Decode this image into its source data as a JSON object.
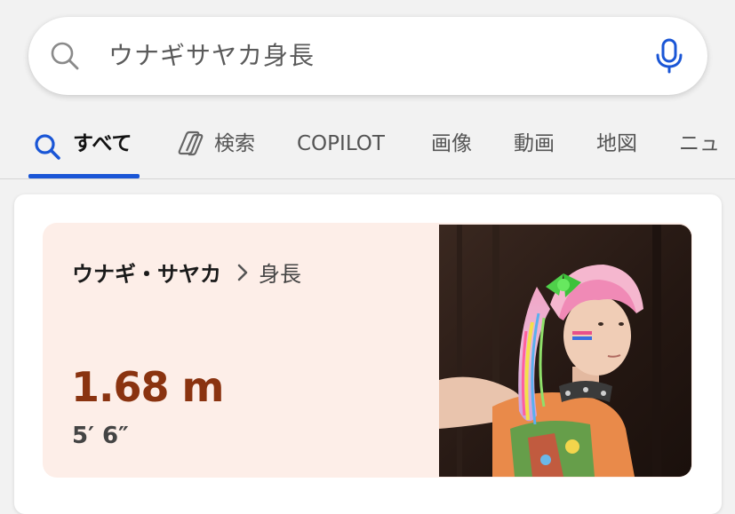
{
  "search": {
    "query": "ウナギサヤカ身長"
  },
  "tabs": [
    {
      "label": "すべて",
      "icon": "search-icon",
      "active": true
    },
    {
      "label": "検索",
      "icon": "copilot-icon",
      "active": false
    },
    {
      "label": "COPILOT",
      "active": false
    },
    {
      "label": "画像",
      "active": false
    },
    {
      "label": "動画",
      "active": false
    },
    {
      "label": "地図",
      "active": false
    },
    {
      "label": "ニュ",
      "active": false
    }
  ],
  "answer": {
    "entity": "ウナギ・サヤカ",
    "attribute": "身長",
    "value_metric": "1.68 m",
    "value_imperial": "5′ 6″",
    "image": "portrait-photo"
  },
  "colors": {
    "accent": "#1a56d6",
    "answer_bg": "#fdeee8",
    "value_color": "#8a3310"
  }
}
